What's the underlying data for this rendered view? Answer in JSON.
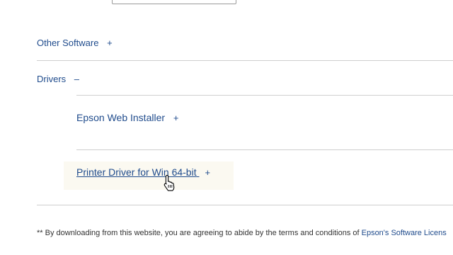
{
  "sections": {
    "other_software": {
      "label": "Other Software",
      "toggle": "+"
    },
    "drivers": {
      "label": "Drivers",
      "toggle": "–"
    }
  },
  "drivers": {
    "items": [
      {
        "label": "Epson Web Installer",
        "toggle": "+"
      },
      {
        "label": "Printer Driver for Win 64-bit",
        "toggle": "+"
      }
    ]
  },
  "footer": {
    "prefix": "** By downloading from this website, you are agreeing to abide by the terms and conditions of ",
    "link": "Epson's Software Licens"
  },
  "colors": {
    "link": "#1f4b8c",
    "rule": "#cfcfcf",
    "hover_bg": "#fbf9f1"
  },
  "icons": {
    "cursor": "hand-pointer-icon"
  }
}
